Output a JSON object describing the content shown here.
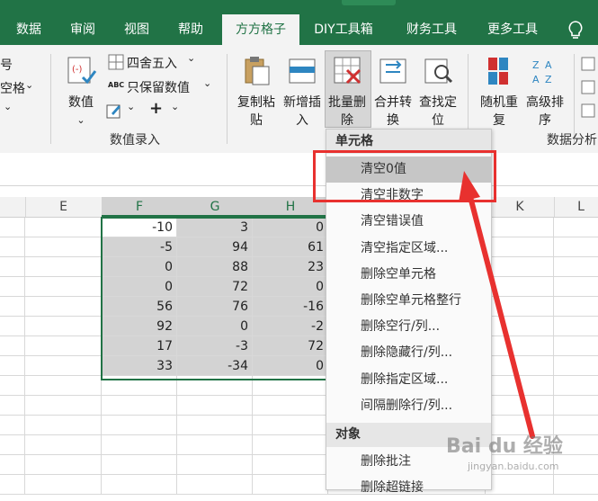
{
  "tabs": [
    {
      "label": "数据"
    },
    {
      "label": "审阅"
    },
    {
      "label": "视图"
    },
    {
      "label": "帮助"
    },
    {
      "label": "方方格子"
    },
    {
      "label": "DIY工具箱"
    },
    {
      "label": "财务工具"
    },
    {
      "label": "更多工具"
    }
  ],
  "ribbon": {
    "left_partial": {
      "line1": "号",
      "line2": "空格"
    },
    "numeric": {
      "label": "数值",
      "round": "四舍五入",
      "keep_value": "只保留数值",
      "plus": "+",
      "group": "数值录入"
    },
    "buttons": [
      {
        "line1": "复制粘",
        "line2": "贴"
      },
      {
        "line1": "新增插",
        "line2": "入"
      },
      {
        "line1": "批量删",
        "line2": "除"
      },
      {
        "line1": "合并转",
        "line2": "换"
      },
      {
        "line1": "查找定",
        "line2": "位"
      },
      {
        "line1": "随机重",
        "line2": "复"
      },
      {
        "line1": "高级排",
        "line2": "序"
      }
    ],
    "group_right": "数据分析"
  },
  "columns": [
    "E",
    "F",
    "G",
    "H",
    "K",
    "L"
  ],
  "grid": {
    "rows": [
      [
        "-10",
        "3",
        "0"
      ],
      [
        "-5",
        "94",
        "61"
      ],
      [
        "0",
        "88",
        "23"
      ],
      [
        "0",
        "72",
        "0"
      ],
      [
        "56",
        "76",
        "-16"
      ],
      [
        "92",
        "0",
        "-2"
      ],
      [
        "17",
        "-3",
        "72"
      ],
      [
        "33",
        "-34",
        "0"
      ]
    ]
  },
  "menu": {
    "header1": "单元格",
    "items1": [
      "清空0值",
      "清空非数字",
      "清空错误值",
      "清空指定区域...",
      "删除空单元格",
      "删除空单元格整行",
      "删除空行/列...",
      "删除隐藏行/列...",
      "删除指定区域...",
      "间隔删除行/列..."
    ],
    "header2": "对象",
    "items2": [
      "删除批注",
      "删除超链接"
    ]
  },
  "watermark": "Bai du 经验",
  "watermark_sub": "jingyan.baidu.com",
  "colors": {
    "accent": "#217346",
    "highlight": "#e8312f"
  }
}
